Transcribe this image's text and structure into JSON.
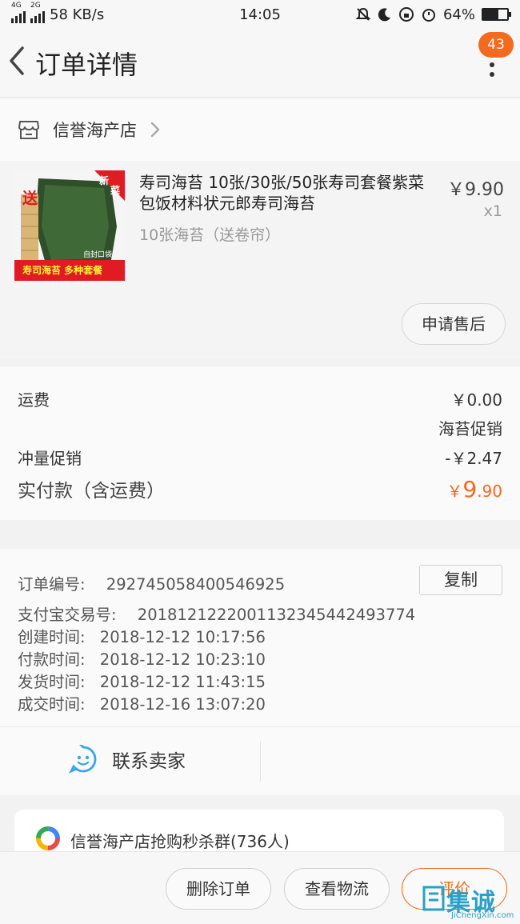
{
  "status_bar": {
    "net_left_top": "4G",
    "net_left_2g": "2G",
    "speed": "58 KB/s",
    "time": "14:05",
    "battery": "64%",
    "battery_fraction": 0.64
  },
  "header": {
    "title": "订单详情",
    "badge_count": "43"
  },
  "store": {
    "name": "信誉海产店"
  },
  "product": {
    "title": "寿司海苔 10张/30张/50张寿司套餐紫菜包饭材料状元郎寿司海苔",
    "sku": "10张海苔（送卷帘）",
    "price": "￥9.90",
    "qty": "x1",
    "after_sale_label": "申请售后",
    "thumb_texts": {
      "gift": "送",
      "new": "新",
      "dish": "菜",
      "bag": "自封口袋",
      "banner": "寿司海苔 多种套餐"
    }
  },
  "cost": {
    "shipping_label": "运费",
    "shipping_value": "￥0.00",
    "promo_name": "海苔促销",
    "discount_label": "冲量促销",
    "discount_value": "-￥2.47",
    "paid_label": "实付款（含运费）",
    "paid_currency": "￥",
    "paid_int": "9",
    "paid_dec": ".90"
  },
  "order_info": {
    "order_no_label": "订单编号:",
    "order_no": "292745058400546925",
    "copy_label": "复制",
    "alipay_label": "支付宝交易号:",
    "alipay_no": "2018121222001132345442493774",
    "created_label": "创建时间:",
    "created": "2018-12-12 10:17:56",
    "paid_label": "付款时间:",
    "paid": "2018-12-12 10:23:10",
    "shipped_label": "发货时间:",
    "shipped": "2018-12-12 11:43:15",
    "closed_label": "成交时间:",
    "closed": "2018-12-16 13:07:20"
  },
  "contact": {
    "label": "联系卖家"
  },
  "group": {
    "name": "信誉海产店抢购秒杀群(736人)"
  },
  "bottom": {
    "delete_label": "删除订单",
    "logistics_label": "查看物流",
    "review_label": "评价"
  },
  "watermark": {
    "text": "集诚信",
    "url": "JiChengXin.com"
  },
  "colors": {
    "accent": "#f46a1e",
    "contact_icon": "#3aa6e8"
  }
}
